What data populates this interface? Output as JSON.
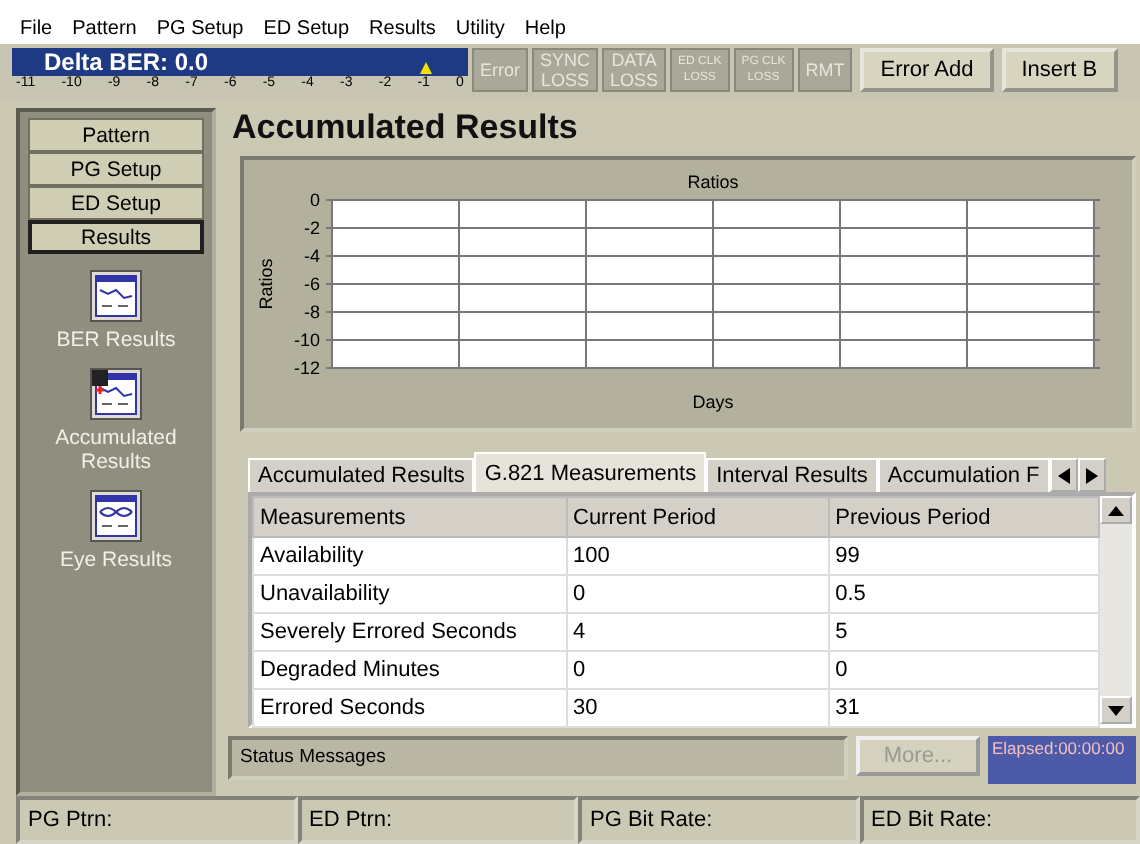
{
  "menu": [
    "File",
    "Pattern",
    "PG Setup",
    "ED Setup",
    "Results",
    "Utility",
    "Help"
  ],
  "delta_ber": {
    "label": "Delta BER: 0.0",
    "level": 0.91,
    "scale": [
      "-11",
      "-10",
      "-9",
      "-8",
      "-7",
      "-6",
      "-5",
      "-4",
      "-3",
      "-2",
      "-1",
      "0"
    ]
  },
  "indicators": [
    {
      "lines": [
        "Error"
      ]
    },
    {
      "lines": [
        "SYNC",
        "LOSS"
      ]
    },
    {
      "lines": [
        "DATA",
        "LOSS"
      ]
    },
    {
      "kind": "small",
      "lines": [
        "ED CLK",
        "LOSS"
      ]
    },
    {
      "kind": "small",
      "lines": [
        "PG CLK",
        "LOSS"
      ]
    },
    {
      "lines": [
        "RMT"
      ]
    }
  ],
  "toolbar_buttons": [
    "Error Add",
    "Insert B"
  ],
  "sidebar": {
    "nav": [
      {
        "label": "Pattern",
        "selected": false
      },
      {
        "label": "PG Setup",
        "selected": false
      },
      {
        "label": "ED Setup",
        "selected": false
      },
      {
        "label": "Results",
        "selected": true
      }
    ],
    "items": [
      {
        "kind": "ber",
        "label": "BER Results"
      },
      {
        "kind": "accumulated",
        "label": "Accumulated Results"
      },
      {
        "kind": "eye",
        "label": "Eye Results"
      }
    ]
  },
  "title": "Accumulated Results",
  "chart": {
    "kind": "grid",
    "title": "Ratios",
    "xlabel": "Days",
    "ylabel": "Ratios",
    "ytick_labels": [
      "0",
      "-2",
      "-4",
      "-6",
      "-8",
      "-10",
      "-12"
    ]
  },
  "tabs": [
    {
      "label": "Accumulated Results",
      "selected": false
    },
    {
      "label": "G.821 Measurements",
      "selected": true
    },
    {
      "label": "Interval Results",
      "selected": false
    },
    {
      "label": "Accumulation F",
      "selected": false
    }
  ],
  "table": {
    "columns": [
      "Measurements",
      "Current Period",
      "Previous Period"
    ],
    "rows": [
      [
        "Availability",
        "100",
        "99"
      ],
      [
        "Unavailability",
        "0",
        "0.5"
      ],
      [
        "Severely Errored Seconds",
        "4",
        "5"
      ],
      [
        "Degraded Minutes",
        "0",
        "0"
      ],
      [
        "Errored Seconds",
        "30",
        "31"
      ]
    ]
  },
  "status": {
    "message_label": "Status Messages",
    "more_button": {
      "label": "More...",
      "disabled": true
    },
    "elapsed": "Elapsed:00:00:00"
  },
  "status_bar": [
    "PG Ptrn:",
    "ED Ptrn:",
    "PG Bit Rate:",
    "ED Bit Rate:"
  ]
}
